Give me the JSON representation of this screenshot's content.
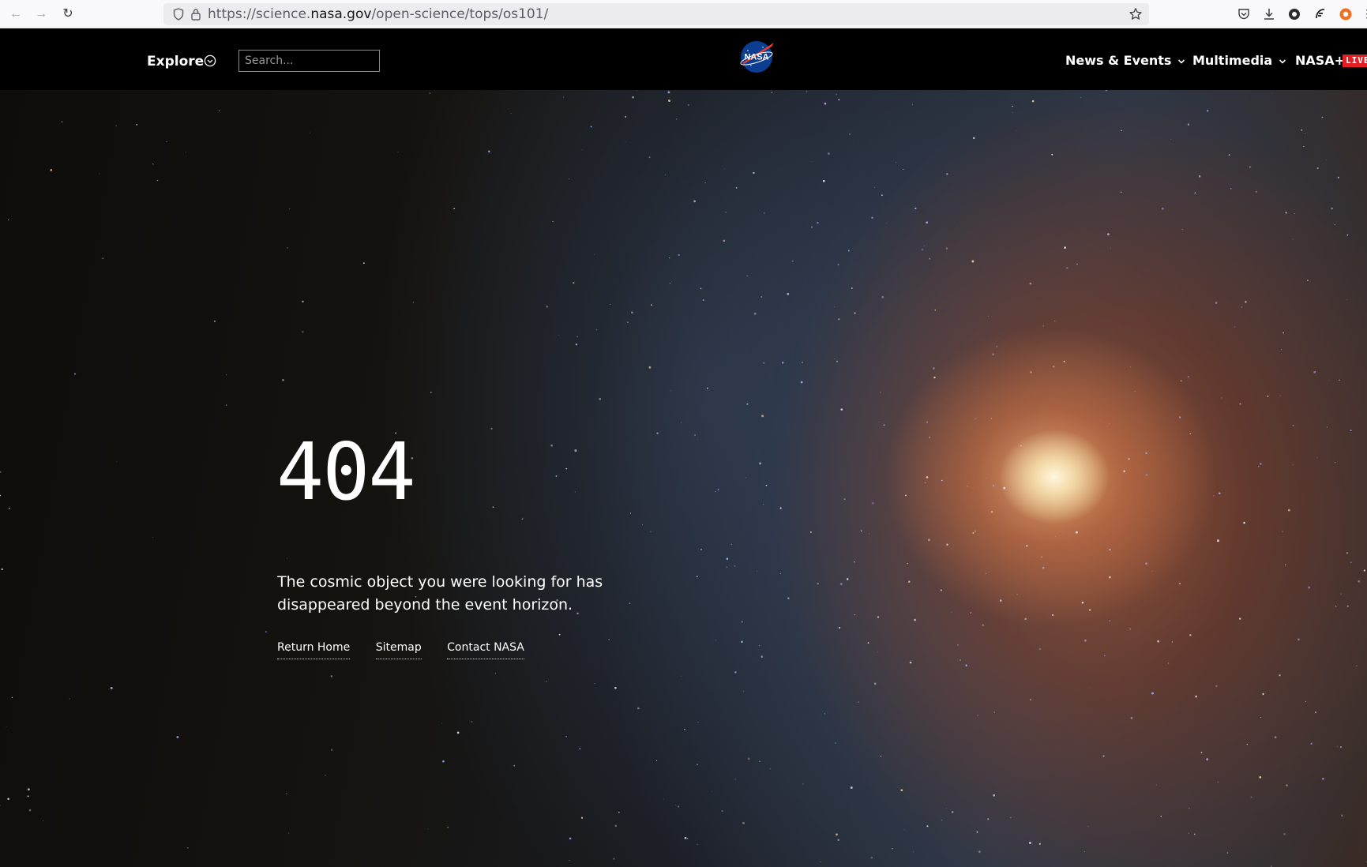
{
  "browser": {
    "url_prefix": "https://science.",
    "url_domain": "nasa.gov",
    "url_path": "/open-science/tops/os101/"
  },
  "header": {
    "explore_label": "Explore",
    "search_placeholder": "Search...",
    "logo_text": "NASA",
    "nav": [
      {
        "label": "News & Events"
      },
      {
        "label": "Multimedia"
      },
      {
        "label": "NASA+"
      }
    ],
    "live_badge": "LIVE"
  },
  "error": {
    "code": "404",
    "message": "The cosmic object you were looking for has disappeared beyond the event horizon.",
    "links": [
      {
        "label": "Return Home"
      },
      {
        "label": "Sitemap"
      },
      {
        "label": "Contact NASA"
      }
    ]
  },
  "colors": {
    "header_bg": "#000000",
    "live_red": "#e41e25",
    "text": "#ffffff"
  }
}
